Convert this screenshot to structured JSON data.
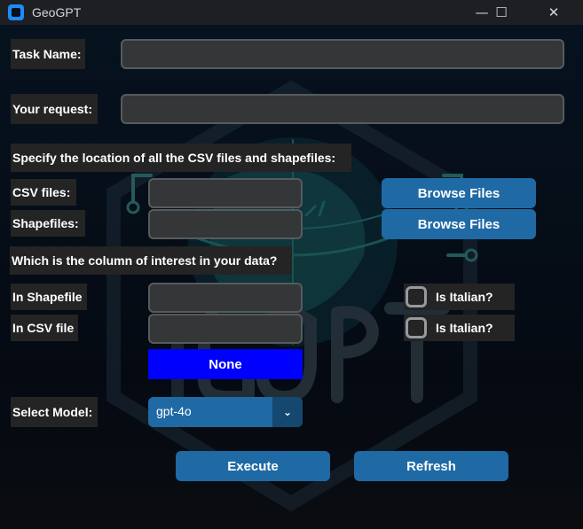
{
  "window": {
    "title": "GeoGPT",
    "minimize_glyph": "—",
    "maximize_glyph": "☐",
    "close_glyph": "✕"
  },
  "form": {
    "task_name_label": "Task Name:",
    "task_name_value": "",
    "request_label": "Your request:",
    "request_value": "",
    "location_heading": "Specify the location of all the CSV files and shapefiles:",
    "csv_files_label": "CSV files:",
    "csv_files_value": "",
    "shapefiles_label": "Shapefiles:",
    "shapefiles_value": "",
    "browse_csv_label": "Browse Files",
    "browse_shp_label": "Browse Files",
    "column_heading": "Which is the column of interest in your data?",
    "in_shapefile_label": "In Shapefile",
    "in_shapefile_value": "",
    "in_csv_label": "In CSV file",
    "in_csv_value": "",
    "shp_italian_label": "Is Italian?",
    "shp_italian_checked": false,
    "csv_italian_label": "Is Italian?",
    "csv_italian_checked": false,
    "none_label": "None",
    "model_label": "Select Model:",
    "model_value": "gpt-4o",
    "execute_label": "Execute",
    "refresh_label": "Refresh"
  },
  "background_logo": {
    "icon": "geogpt-globe-circuit-logo",
    "text": "GeoGPT"
  },
  "colors": {
    "accent": "#1f6aa5",
    "accent_dark": "#144870",
    "none_button": "#0000ff",
    "field_bg": "#343638",
    "field_border": "#565b5e",
    "label_bg": "#242424"
  }
}
